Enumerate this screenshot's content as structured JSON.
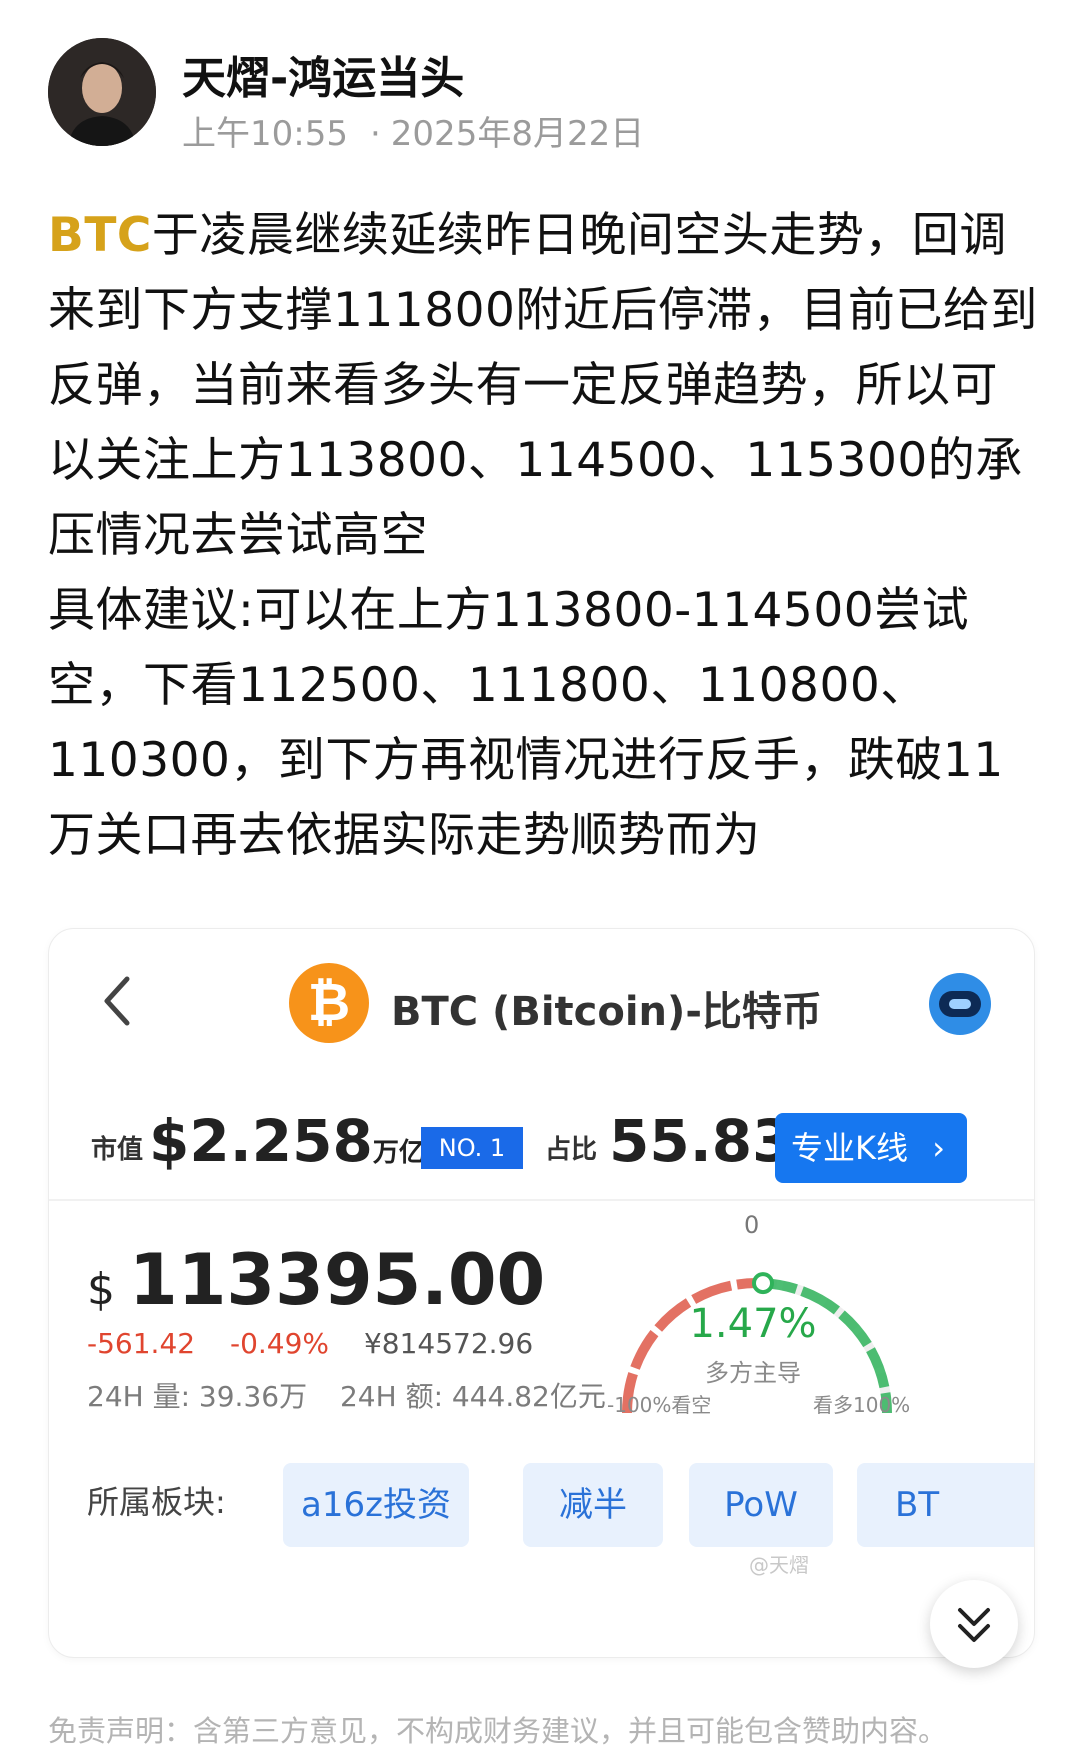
{
  "post": {
    "author": "天熠-鸿运当头",
    "time": "上午10:55",
    "date": "2025年8月22日",
    "ticker": "BTC",
    "paragraph1": "于凌晨继续延续昨日晚间空头走势，回调来到下方支撑111800附近后停滞，目前已给到反弹，当前来看多头有一定反弹趋势，所以可以关注上方113800、114500、115300的承压情况去尝试高空",
    "paragraph2": "具体建议:可以在上方113800-114500尝试空，下看112500、111800、110800、110300，到下方再视情况进行反手，跌破11万关口再去依据实际走势顺势而为"
  },
  "card": {
    "coin_glyph": "₿",
    "coin_title": "BTC (Bitcoin)-比特币",
    "market_cap_label": "市值",
    "market_cap_value": "$2.258",
    "market_cap_unit": "万亿",
    "rank": "NO. 1",
    "share_label": "占比",
    "share_value": "55.83",
    "share_unit": "%",
    "kline_button": "专业K线",
    "price_currency": "$",
    "price": "113395.00",
    "change_abs": "-561.42",
    "change_pct": "-0.49%",
    "price_cny": "¥814572.96",
    "volume_24h": "24H 量: 39.36万",
    "amount_24h": "24H 额: 444.82亿元",
    "gauge_zero": "0",
    "gauge_percent": "1.47%",
    "gauge_status": "多方主导",
    "gauge_left_label": "-100%看空",
    "gauge_right_label": "看多100%",
    "gauge_value_fraction": 0.5147,
    "sectors_label": "所属板块:",
    "sectors": [
      "a16z投资",
      "减半",
      "PoW",
      "BT"
    ],
    "watermark": "@天熠"
  },
  "disclaimer": "免责声明：含第三方意见，不构成财务建议，并且可能包含赞助内容。",
  "colors": {
    "ticker": "#d6a21a",
    "coin": "#f7931a",
    "negative": "#e0452f",
    "positive": "#27a84a",
    "accent": "#1677f0"
  }
}
